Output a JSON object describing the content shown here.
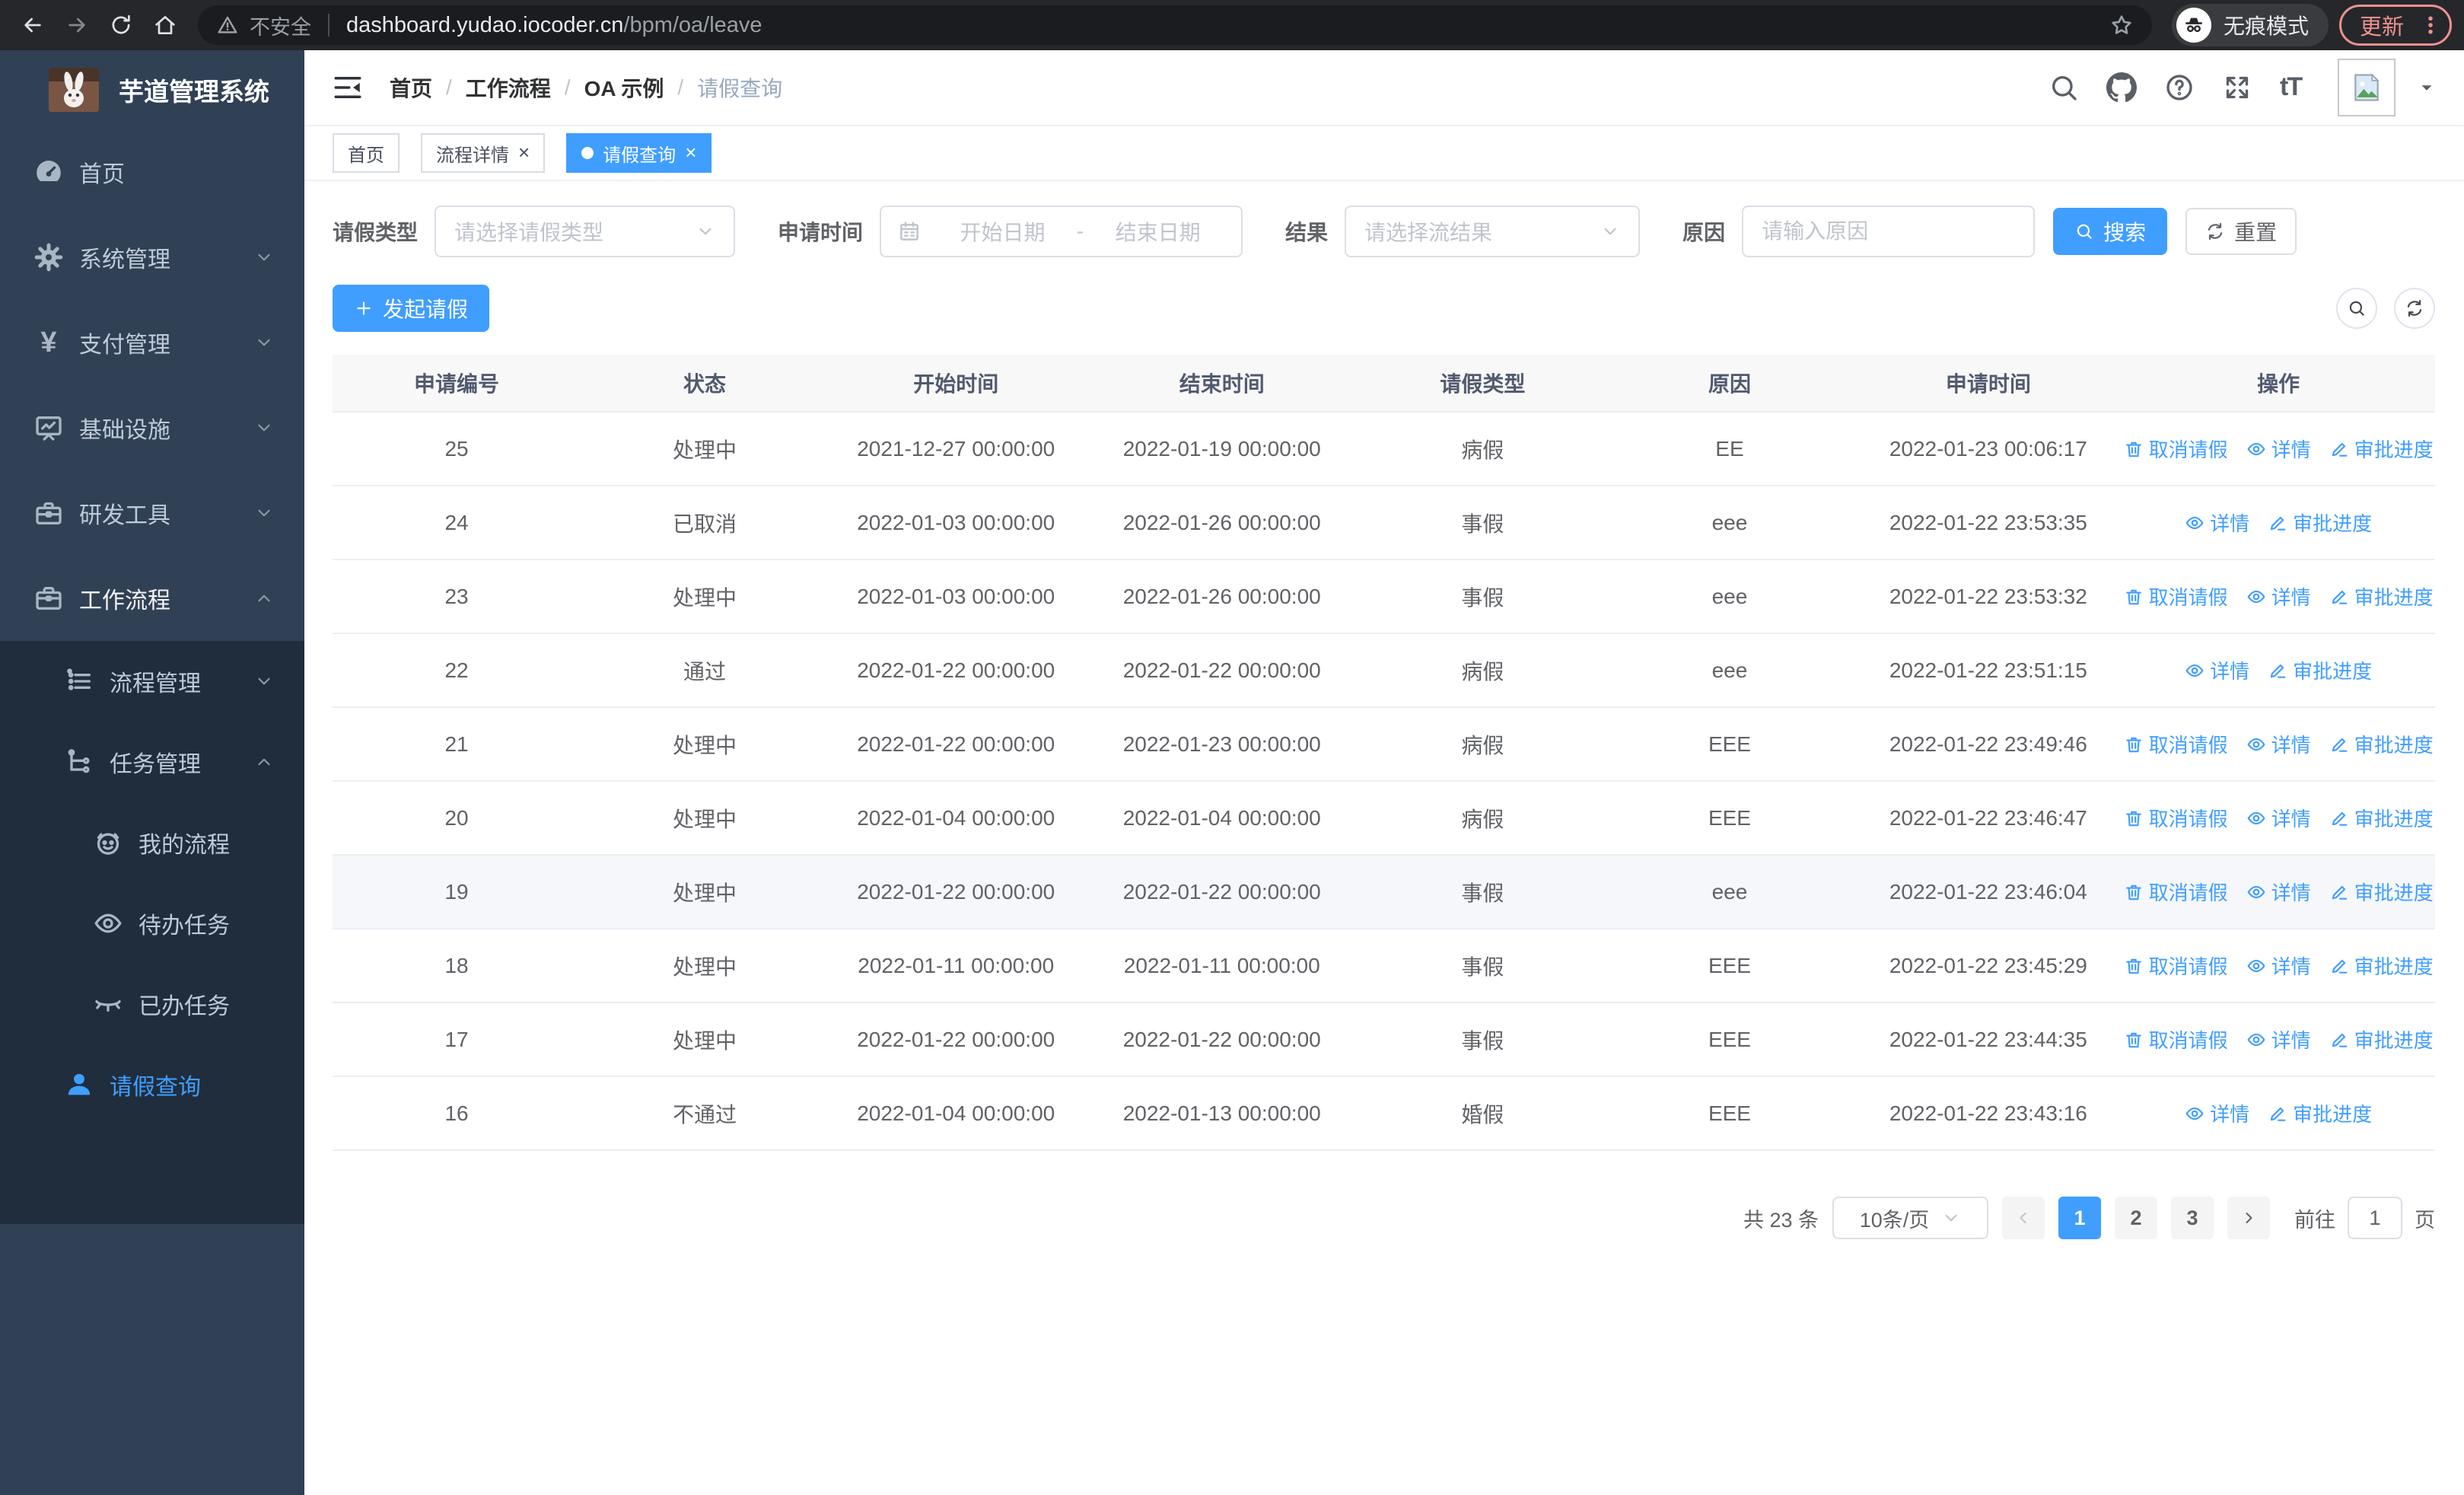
{
  "colors": {
    "primary": "#409EFF",
    "sidebar_bg": "#304156",
    "submenu_bg": "#1f2d3d",
    "update_accent": "#ec928e"
  },
  "browser": {
    "security_label": "不安全",
    "url_host": "dashboard.yudao.iocoder.cn",
    "url_path": "/bpm/oa/leave",
    "incognito_label": "无痕模式",
    "update_label": "更新"
  },
  "sidebar": {
    "app_title": "芋道管理系统",
    "items": [
      {
        "label": "首页"
      },
      {
        "label": "系统管理"
      },
      {
        "label": "支付管理"
      },
      {
        "label": "基础设施"
      },
      {
        "label": "研发工具"
      },
      {
        "label": "工作流程"
      },
      {
        "label": "流程管理"
      },
      {
        "label": "任务管理"
      },
      {
        "label": "我的流程"
      },
      {
        "label": "待办任务"
      },
      {
        "label": "已办任务"
      },
      {
        "label": "请假查询"
      }
    ]
  },
  "header": {
    "breadcrumb": [
      "首页",
      "工作流程",
      "OA 示例",
      "请假查询"
    ]
  },
  "tabs": [
    {
      "label": "首页"
    },
    {
      "label": "流程详情"
    },
    {
      "label": "请假查询"
    }
  ],
  "filters": {
    "leave_type": {
      "label": "请假类型",
      "placeholder": "请选择请假类型"
    },
    "apply_time": {
      "label": "申请时间",
      "start_placeholder": "开始日期",
      "separator": "-",
      "end_placeholder": "结束日期"
    },
    "result": {
      "label": "结果",
      "placeholder": "请选择流结果"
    },
    "reason": {
      "label": "原因",
      "placeholder": "请输入原因"
    },
    "search_label": "搜索",
    "reset_label": "重置"
  },
  "toolbar": {
    "create_label": "发起请假"
  },
  "table": {
    "columns": [
      "申请编号",
      "状态",
      "开始时间",
      "结束时间",
      "请假类型",
      "原因",
      "申请时间",
      "操作"
    ],
    "action_labels": {
      "cancel": "取消请假",
      "detail": "详情",
      "progress": "审批进度"
    },
    "rows": [
      {
        "id": "25",
        "status": "处理中",
        "start": "2021-12-27 00:00:00",
        "end": "2022-01-19 00:00:00",
        "type": "病假",
        "reason": "EE",
        "apply": "2022-01-23 00:06:17",
        "actions": [
          "cancel",
          "detail",
          "progress"
        ],
        "highlight": false
      },
      {
        "id": "24",
        "status": "已取消",
        "start": "2022-01-03 00:00:00",
        "end": "2022-01-26 00:00:00",
        "type": "事假",
        "reason": "eee",
        "apply": "2022-01-22 23:53:35",
        "actions": [
          "detail",
          "progress"
        ],
        "highlight": false
      },
      {
        "id": "23",
        "status": "处理中",
        "start": "2022-01-03 00:00:00",
        "end": "2022-01-26 00:00:00",
        "type": "事假",
        "reason": "eee",
        "apply": "2022-01-22 23:53:32",
        "actions": [
          "cancel",
          "detail",
          "progress"
        ],
        "highlight": false
      },
      {
        "id": "22",
        "status": "通过",
        "start": "2022-01-22 00:00:00",
        "end": "2022-01-22 00:00:00",
        "type": "病假",
        "reason": "eee",
        "apply": "2022-01-22 23:51:15",
        "actions": [
          "detail",
          "progress"
        ],
        "highlight": false
      },
      {
        "id": "21",
        "status": "处理中",
        "start": "2022-01-22 00:00:00",
        "end": "2022-01-23 00:00:00",
        "type": "病假",
        "reason": "EEE",
        "apply": "2022-01-22 23:49:46",
        "actions": [
          "cancel",
          "detail",
          "progress"
        ],
        "highlight": false
      },
      {
        "id": "20",
        "status": "处理中",
        "start": "2022-01-04 00:00:00",
        "end": "2022-01-04 00:00:00",
        "type": "病假",
        "reason": "EEE",
        "apply": "2022-01-22 23:46:47",
        "actions": [
          "cancel",
          "detail",
          "progress"
        ],
        "highlight": false
      },
      {
        "id": "19",
        "status": "处理中",
        "start": "2022-01-22 00:00:00",
        "end": "2022-01-22 00:00:00",
        "type": "事假",
        "reason": "eee",
        "apply": "2022-01-22 23:46:04",
        "actions": [
          "cancel",
          "detail",
          "progress"
        ],
        "highlight": true
      },
      {
        "id": "18",
        "status": "处理中",
        "start": "2022-01-11 00:00:00",
        "end": "2022-01-11 00:00:00",
        "type": "事假",
        "reason": "EEE",
        "apply": "2022-01-22 23:45:29",
        "actions": [
          "cancel",
          "detail",
          "progress"
        ],
        "highlight": false
      },
      {
        "id": "17",
        "status": "处理中",
        "start": "2022-01-22 00:00:00",
        "end": "2022-01-22 00:00:00",
        "type": "事假",
        "reason": "EEE",
        "apply": "2022-01-22 23:44:35",
        "actions": [
          "cancel",
          "detail",
          "progress"
        ],
        "highlight": false
      },
      {
        "id": "16",
        "status": "不通过",
        "start": "2022-01-04 00:00:00",
        "end": "2022-01-13 00:00:00",
        "type": "婚假",
        "reason": "EEE",
        "apply": "2022-01-22 23:43:16",
        "actions": [
          "detail",
          "progress"
        ],
        "highlight": false
      }
    ]
  },
  "pagination": {
    "total_label": "共 23 条",
    "page_size": "10条/页",
    "pages": [
      "1",
      "2",
      "3"
    ],
    "active_page": "1",
    "goto_label": "前往",
    "goto_value": "1",
    "page_suffix": "页"
  }
}
